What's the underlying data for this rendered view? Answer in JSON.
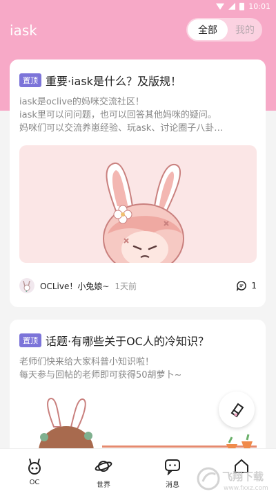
{
  "status_bar": {
    "time": "10:01"
  },
  "header": {
    "app_title": "iask",
    "segment": {
      "all": "全部",
      "mine": "我的"
    }
  },
  "posts": [
    {
      "badge": "置顶",
      "title": "重要·iask是什么？及版规！",
      "body_lines": [
        "iask是oclive的妈咪交流社区！",
        "iask里可以问问题，也可以回答其他妈咪的疑问。",
        "妈咪们可以交流养崽经验、玩ask、讨论圈子八卦…"
      ],
      "author": "OCLive！小兔娘~",
      "time": "1天前",
      "comment_count": "1"
    },
    {
      "badge": "置顶",
      "title": "话题·有哪些关于OC人的冷知识？",
      "body_lines": [
        "老师们快来给大家科普小知识啦！",
        "每天参与回帖的老师即可获得50胡萝卜~"
      ]
    }
  ],
  "tabbar": {
    "tabs": [
      {
        "label": "OC",
        "icon": "bunny-face-icon"
      },
      {
        "label": "世界",
        "icon": "planet-icon"
      },
      {
        "label": "消息",
        "icon": "chat-bubble-icon"
      },
      {
        "label": "",
        "icon": "home-icon"
      }
    ]
  },
  "watermark": {
    "brand": "飞翔下载",
    "url": "www.fxxz.com"
  },
  "colors": {
    "header_pink": "#f7a9c7",
    "badge_purple": "#7c74d9",
    "image_bg": "#fbe6e6"
  }
}
